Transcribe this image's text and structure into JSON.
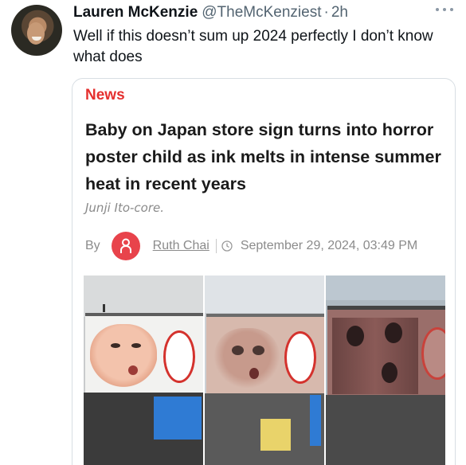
{
  "tweet": {
    "display_name": "Lauren McKenzie",
    "handle": "@TheMcKenziest",
    "separator": "·",
    "time": "2h",
    "text": "Well if this doesn’t sum up 2024 perfectly I don’t know what does"
  },
  "card": {
    "category": "News",
    "headline": "Baby on Japan store sign turns into horror poster child as ink melts in intense summer heat in recent years",
    "subtitle": "Junji Ito-core.",
    "by_label": "By",
    "author": "Ruth Chai",
    "date": "September 29, 2024, 03:49 PM"
  },
  "colors": {
    "news_red": "#e5302f",
    "author_badge": "#e8434b",
    "handle_gray": "#536471"
  },
  "icons": [
    "more-options-icon",
    "author-person-icon",
    "clock-icon"
  ]
}
